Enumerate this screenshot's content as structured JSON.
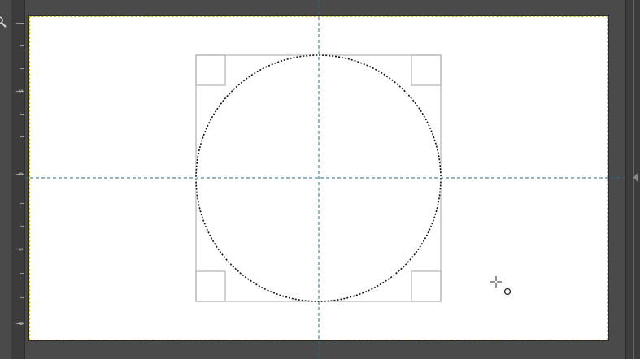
{
  "app": {
    "view": "image-canvas"
  },
  "left_ruler": {
    "labels": [
      "5",
      "0",
      "5",
      "0"
    ]
  },
  "tool": {
    "active": "ellipse-select",
    "cursor_icon": "crosshair-ellipse-cursor-icon"
  },
  "colors": {
    "canvas": "#ffffff",
    "guide": "#1f6f8b",
    "selection": "#000000",
    "shape_outline": "#bbbbbb",
    "canvas_boundary": "#c9c233"
  }
}
